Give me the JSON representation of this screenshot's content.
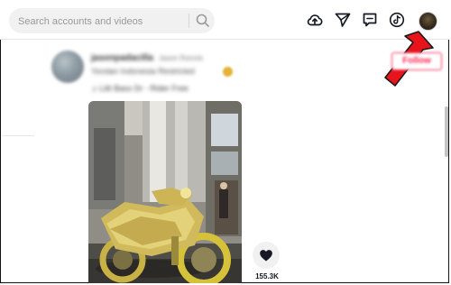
{
  "header": {
    "search": {
      "placeholder": "Search accounts and videos",
      "icon": "search-icon"
    },
    "actions": [
      {
        "name": "upload",
        "icon": "cloud-upload-icon"
      },
      {
        "name": "messages",
        "icon": "paper-plane-icon"
      },
      {
        "name": "inbox",
        "icon": "inbox-message-icon"
      },
      {
        "name": "tiktok",
        "icon": "tiktok-logo-icon"
      },
      {
        "name": "profile",
        "icon": "avatar"
      }
    ]
  },
  "annotation": {
    "arrow_color": "#e8141c"
  },
  "post": {
    "username": "jasonpadacilla",
    "nickname": "Jason Ronnie",
    "description": "Yondan Indonesia Restricted",
    "music": "♫ Lilit Bass Dr - Rider Free",
    "follow_label": "Follow",
    "like_count": "155.3K"
  },
  "colors": {
    "accent": "#fe2c55",
    "search_bg": "#f1f1f2",
    "text": "#161823"
  }
}
